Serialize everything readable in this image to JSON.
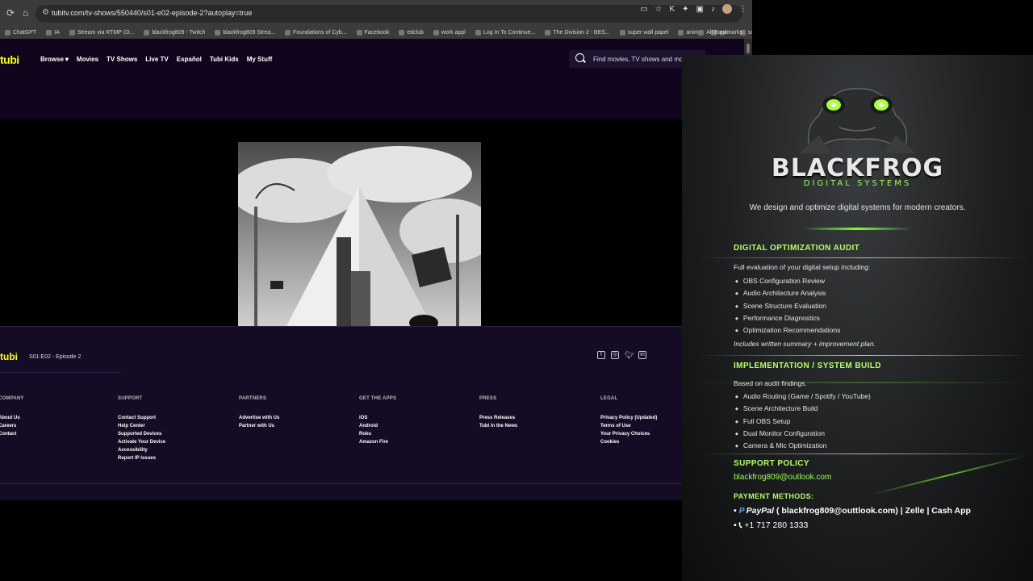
{
  "browser": {
    "url": "tubitv.com/tv-shows/550440/s01-e02-episode-2?autoplay=true",
    "bookmarks": [
      "ChatGPT",
      "IA",
      "Stream via RTMP (O...",
      "blackfrog809 - Twitch",
      "blackfrog809 Strea...",
      "Foundations of Cyb...",
      "Facebook",
      "edclub",
      "work appl",
      "Log In To Continue...",
      "The Division 2 - BES...",
      "super wall papel",
      "anime",
      "gym",
      "social media"
    ],
    "all_bookmarks": "All Bookmarks"
  },
  "tubi": {
    "logo": "tubi",
    "nav": [
      "Browse",
      "Movies",
      "TV Shows",
      "Live TV",
      "Español",
      "Tubi Kids",
      "My Stuff"
    ],
    "search_placeholder": "Find movies, TV shows and more",
    "episode_label": "S01:E02 - Episode 2",
    "footer_columns": [
      {
        "title": "COMPANY",
        "links": [
          "About Us",
          "Careers",
          "Contact"
        ]
      },
      {
        "title": "SUPPORT",
        "links": [
          "Contact Support",
          "Help Center",
          "Supported Devices",
          "Activate Your Device",
          "Accessibility",
          "Report IP Issues"
        ]
      },
      {
        "title": "PARTNERS",
        "links": [
          "Advertise with Us",
          "Partner with Us"
        ]
      },
      {
        "title": "GET THE APPS",
        "links": [
          "iOS",
          "Android",
          "Roku",
          "Amazon Fire"
        ]
      },
      {
        "title": "PRESS",
        "links": [
          "Press Releases",
          "Tubi in the News"
        ]
      },
      {
        "title": "LEGAL",
        "links": [
          "Privacy Policy (Updated)",
          "Terms of Use",
          "Your Privacy Choices",
          "Cookies"
        ]
      }
    ]
  },
  "overlay": {
    "brand": "BLACKFROG",
    "brand_sub": "DIGITAL SYSTEMS",
    "tagline": "We design and optimize digital systems for modern creators.",
    "audit_title": "DIGITAL OPTIMIZATION AUDIT",
    "audit_intro": "Full evaluation of your digital setup including:",
    "audit_items": [
      "OBS Configuration Review",
      "Audio Architecture Analysis",
      "Scene Structure Evaluation",
      "Performance Diagnostics",
      "Optimization Recommendations"
    ],
    "audit_note": "Includes written summary + improvement plan.",
    "build_title": "IMPLEMENTATION / SYSTEM BUILD",
    "build_intro": "Based on audit findings.",
    "build_items": [
      "Audio Routing (Game / Spotify / YouTube)",
      "Scene Architecture Build",
      "Full OBS Setup",
      "Dual Monitor Configuration",
      "Camera & Mic Optimization"
    ],
    "support_title": "SUPPORT POLICY",
    "support_email": "blackfrog809@outlook.com",
    "payment_title": "PAYMENT METHODS:",
    "paypal_label": "PayPal",
    "paypal_detail": "( blackfrog809@outtlook.com) | Zelle | Cash App",
    "phone": "+1 717 280 1333"
  },
  "colors": {
    "tubi_yellow": "#ffff13",
    "tubi_bg": "#10051d",
    "overlay_accent": "#9cff55"
  }
}
